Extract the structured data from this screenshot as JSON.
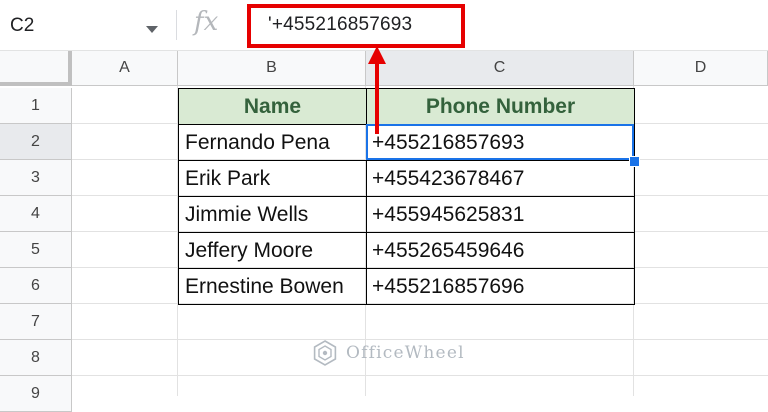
{
  "formula_bar": {
    "cell_ref": "C2",
    "fx_label": "fx",
    "formula": "'+455216857693"
  },
  "columns": [
    "A",
    "B",
    "C",
    "D"
  ],
  "rows": [
    "1",
    "2",
    "3",
    "4",
    "5",
    "6",
    "7",
    "8",
    "9"
  ],
  "table": {
    "headers": [
      "Name",
      "Phone Number"
    ],
    "rows": [
      [
        "Fernando Pena",
        "+455216857693"
      ],
      [
        "Erik Park",
        "+455423678467"
      ],
      [
        "Jimmie Wells",
        "+455945625831"
      ],
      [
        "Jeffery Moore",
        "+455265459646"
      ],
      [
        "Ernestine Bowen",
        "+455216857696"
      ]
    ]
  },
  "watermark": "OfficeWheel",
  "colors": {
    "header_fill": "#d9ead3",
    "header_text": "#34623c",
    "selection": "#1a73e8",
    "annotation": "#e60000"
  }
}
